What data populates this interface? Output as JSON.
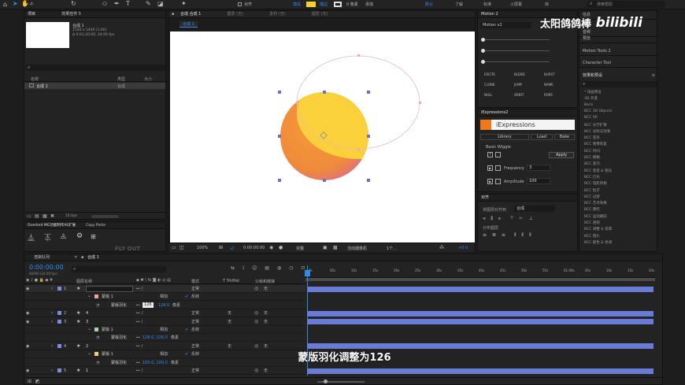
{
  "toolbar": {
    "align_label": "对齐",
    "fill_label": "填充",
    "stroke_label": "描边",
    "stroke_size": "0 像素",
    "add_label": "添加",
    "workspaces": [
      "默认",
      "了解",
      "标准",
      "小屏幕",
      "库"
    ],
    "search_placeholder": "搜索帮助"
  },
  "project_panel": {
    "tabs": [
      "项目",
      "效果控件 5"
    ],
    "comp_name": "合成 1",
    "comp_info_1": "1540 x 1440 (1.00)",
    "comp_info_2": "Δ 0:01:20:00, 24.00 fps",
    "columns": [
      "名称",
      "类型",
      "大小"
    ],
    "items": [
      {
        "name": "合成 1",
        "type": "合成"
      }
    ],
    "bpc": "16 bpc"
  },
  "overlord_panel": {
    "tabs": [
      "Overlord  MG功能制作AE扩展",
      "Copy Paste"
    ],
    "faded_text": "FLY OUT"
  },
  "comp_viewer": {
    "tabs": [
      "合成  合成 1",
      "图层 (无)",
      "素材 (无)",
      "图层 (无)"
    ],
    "active_tab": "合成 1",
    "zoom": "100%",
    "timecode": "0:00:00:00",
    "resolution": "完整",
    "camera": "活动摄像机",
    "views": "1个...",
    "exposure": "+0.0"
  },
  "motion2": {
    "title": "Motion 2",
    "preset": "Motion v2",
    "buttons": [
      "EXCITE",
      "BLEND",
      "BURST",
      "CLONE",
      "JUMP",
      "NAME",
      "NULL",
      "ORBIT",
      "ROPE"
    ]
  },
  "iexpressions": {
    "title": "iExpressions2",
    "brand": "iExpressions",
    "tabs": [
      "Library",
      "Load",
      "Bake"
    ],
    "section": "Basic Wiggle",
    "apply": "Apply",
    "params": [
      {
        "label": "Frequency",
        "value": "3"
      },
      {
        "label": "Amplitude",
        "value": "100"
      }
    ]
  },
  "align_panel": {
    "title": "对齐",
    "align_to_label": "将图层对齐到",
    "align_to_value": "合成",
    "distribute_label": "分布图层"
  },
  "right_panel": {
    "items": [
      "信息",
      "音频",
      "预览",
      "Motion Tools 2",
      "Character Tool"
    ],
    "effects_title": "效果和预设",
    "effects": [
      "* 动画预设",
      "3D 声道",
      "Boris",
      "BCC 3D Objects",
      "BCC VR",
      "BCC 光学扩散",
      "BCC 光照与效果",
      "BCC 变形",
      "BCC 图像恢复",
      "BCC 时间",
      "BCC 模糊",
      "BCC 混沌",
      "BCC 渐变 & 锐化",
      "BCC 灯光",
      "BCC 电影风格",
      "BCC 粒子",
      "BCC 过渡",
      "BCC 艺术效果",
      "BCC 键控",
      "BCC 运动跟踪",
      "BCC 透视",
      "BCC 调整 & 遮罩",
      "BCC 镜头",
      "BCC 颜色 & 色调"
    ]
  },
  "watermark": {
    "author": "太阳鸽鸽棒",
    "platform": "bilibili"
  },
  "timeline": {
    "tabs": [
      "渲染队列",
      "合成 1"
    ],
    "timecode": "0:00:00:00",
    "timecode_sub": "00000 (24.00 fps)",
    "columns": [
      "图层名称",
      "模式",
      "T TrkMat",
      "父级和链接"
    ],
    "ruler": [
      "0s",
      "05s",
      "10s",
      "15s",
      "20s",
      "25s",
      "30s",
      "35s",
      "40s",
      "45s",
      "50s",
      "55s",
      "01:00s",
      "05s",
      "10s",
      "15s",
      "20s"
    ],
    "layers": [
      {
        "num": "1",
        "name": "",
        "mode": "正常",
        "parent": "无",
        "color": "#7b8bdf",
        "editing": true
      },
      {
        "num": "",
        "name": "蒙版 1",
        "mode": "相加",
        "parent": "反转",
        "color": "#e9a5a5",
        "sub": true
      },
      {
        "num": "",
        "name": "蒙版羽化",
        "mode": "126",
        "parent": "像素",
        "sub2": true,
        "value_extra": "126.0"
      },
      {
        "num": "2",
        "name": "4",
        "mode": "正常",
        "trk": "无",
        "parent": "无",
        "color": "#7b8bdf"
      },
      {
        "num": "3",
        "name": "3",
        "mode": "正常",
        "trk": "无",
        "parent": "无",
        "color": "#7b8bdf"
      },
      {
        "num": "",
        "name": "蒙版 1",
        "mode": "相加",
        "parent": "反转",
        "color": "#a5d9a5",
        "sub": true
      },
      {
        "num": "",
        "name": "蒙版羽化",
        "mode": "126.0, 126.0",
        "parent": "像素",
        "sub2": true
      },
      {
        "num": "4",
        "name": "2",
        "mode": "正常",
        "trk": "无",
        "parent": "无",
        "color": "#7b8bdf"
      },
      {
        "num": "",
        "name": "蒙版 1",
        "mode": "相加",
        "parent": "反转",
        "color": "#e9d07a",
        "sub": true
      },
      {
        "num": "",
        "name": "蒙版羽化",
        "mode": "100.0, 100.0",
        "parent": "像素",
        "sub2": true
      },
      {
        "num": "5",
        "name": "1",
        "mode": "正常",
        "trk": "",
        "parent": "无",
        "color": "#7b8bdf"
      }
    ],
    "footer": "切换开关/模式"
  },
  "subtitle": "蒙版羽化调整为126",
  "colors": {
    "accent": "#2d8ceb",
    "layer_blue": "#6a7bd6",
    "fill_yellow": "#f5d02a"
  }
}
